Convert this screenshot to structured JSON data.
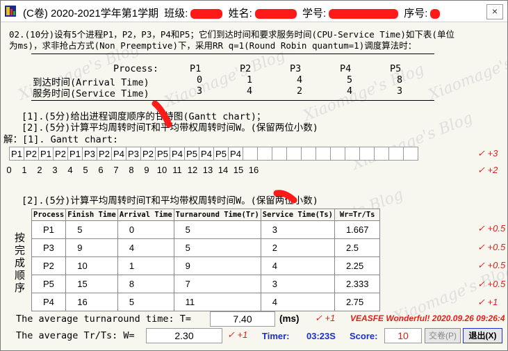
{
  "window": {
    "title_prefix": "(C卷) 2020-2021学年第1学期",
    "class_label": "班级:",
    "name_label": "姓名:",
    "id_label": "学号:",
    "seq_label": "序号:",
    "close_glyph": "×"
  },
  "question": {
    "line1": "02.(10分)设有5个进程P1，P2，P3，P4和P5；它们到达时间和要求服务时间(CPU-Service Time)如下表(单位",
    "line2": "为ms)，求非抢占方式(Non Preemptive)下，采用RR q=1(Round Robin quantum=1)调度算法时：",
    "process_label": "Process:",
    "processes": [
      "P1",
      "P2",
      "P3",
      "P4",
      "P5"
    ],
    "arrival_label": "到达时间(Arrival Time)",
    "arrival": [
      "0",
      "1",
      "4",
      "5",
      "8"
    ],
    "service_label": "服务时间(Service Time)",
    "service": [
      "3",
      "4",
      "2",
      "4",
      "3"
    ],
    "sub1": "[1].(5分)给出进程调度顺序的甘特图(Gantt chart)；",
    "sub2": "[2].(5分)计算平均周转时间T和平均带权周转时间W。(保留两位小数)"
  },
  "answer": {
    "gantt_label": "解：[1]. Gantt chart:",
    "gantt": [
      "P1",
      "P2",
      "P1",
      "P2",
      "P1",
      "P3",
      "P2",
      "P4",
      "P3",
      "P2",
      "P5",
      "P4",
      "P5",
      "P4",
      "P5",
      "P4",
      "",
      "",
      "",
      "",
      "",
      "",
      "",
      "",
      "",
      "",
      "",
      ""
    ],
    "time_ticks": [
      "0",
      "1",
      "2",
      "3",
      "4",
      "5",
      "6",
      "7",
      "8",
      "9",
      "10",
      "11",
      "12",
      "13",
      "14",
      "15",
      "16",
      "",
      "",
      "",
      "",
      "",
      "",
      "",
      "",
      "",
      "",
      "",
      ""
    ],
    "gantt_score": "✓ +3",
    "time_score": "✓ +2",
    "part2_label": "[2].(5分)计算平均周转时间T和平均带权周转时间W。(保留两位小数)",
    "side_label": [
      "按",
      "完",
      "成",
      "顺",
      "序"
    ],
    "table_headers": [
      "Process",
      "Finish Time",
      "Arrival Time",
      "Turnaround Time(Tr)",
      "Service Time(Ts)",
      "Wr=Tr/Ts"
    ],
    "table_rows": [
      [
        "P1",
        "5",
        "0",
        "5",
        "3",
        "1.667"
      ],
      [
        "P3",
        "9",
        "4",
        "5",
        "2",
        "2.5"
      ],
      [
        "P2",
        "10",
        "1",
        "9",
        "4",
        "2.25"
      ],
      [
        "P5",
        "15",
        "8",
        "7",
        "3",
        "2.333"
      ],
      [
        "P4",
        "16",
        "5",
        "11",
        "4",
        "2.75"
      ]
    ],
    "row_scores": [
      "✓ +0.5",
      "✓ +0.5",
      "✓ +0.5",
      "✓ +0.5",
      "✓ +1"
    ],
    "avg_turnaround_label": "The average turnaround time: T=",
    "avg_turnaround_value": "7.40",
    "avg_turnaround_unit": "(ms)",
    "avg_turnaround_score": "✓ +1",
    "wonderful": "VEASFE Wonderful! 2020.09.26 09:26:4",
    "avg_w_label": "The average Tr/Ts: W=",
    "avg_w_value": "2.30",
    "avg_w_score": "✓ +1",
    "timer_label": "Timer:",
    "timer_value": "03:23S",
    "score_label": "Score:",
    "score_value": "10",
    "submit_btn": "交卷(P)",
    "exit_btn": "退出(X)"
  },
  "watermark_text": "Xiaomage's Blog",
  "colors": {
    "red": "#e0201a",
    "blue": "#1a2fd0",
    "score_red": "#e0201a"
  }
}
